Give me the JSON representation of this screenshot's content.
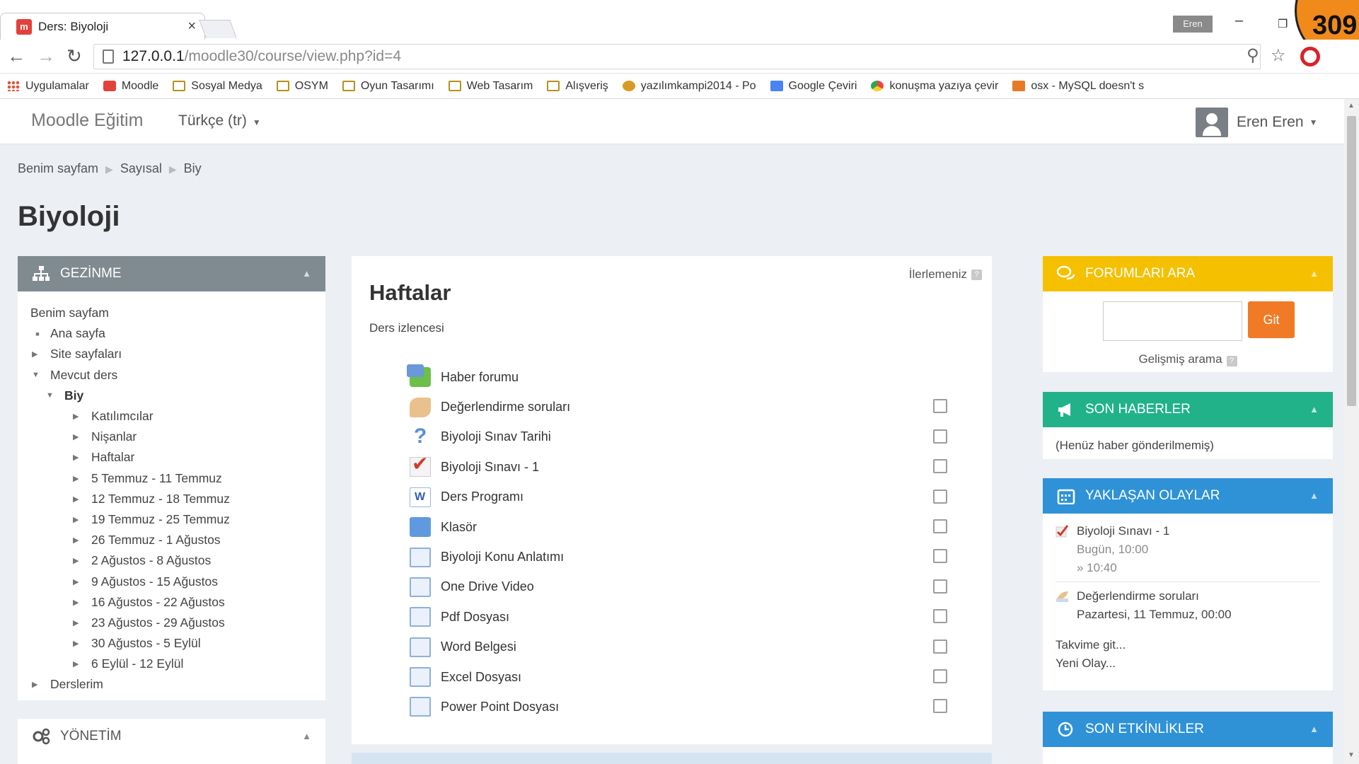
{
  "browser": {
    "tab_title": "Ders: Biyoloji",
    "tab_close": "×",
    "profile_name": "Eren",
    "badge_number": "309",
    "url_host": "127.0.0.1",
    "url_path": "/moodle30/course/view.php?id=4",
    "bookmarks": [
      {
        "label": "Uygulamalar",
        "icon": "apps-icon"
      },
      {
        "label": "Moodle",
        "icon": "moodle-icon"
      },
      {
        "label": "Sosyal Medya",
        "icon": "folder-icon"
      },
      {
        "label": "OSYM",
        "icon": "folder-icon"
      },
      {
        "label": "Oyun Tasarımı",
        "icon": "folder-icon"
      },
      {
        "label": "Web Tasarım",
        "icon": "folder-icon"
      },
      {
        "label": "Alışveriş",
        "icon": "folder-icon"
      },
      {
        "label": "yazılımkampi2014 - Po",
        "icon": "site-icon"
      },
      {
        "label": "Google Çeviri",
        "icon": "translate-icon"
      },
      {
        "label": "konuşma yazıya çevir",
        "icon": "chrome-icon"
      },
      {
        "label": "osx - MySQL doesn't s",
        "icon": "java-icon"
      }
    ]
  },
  "navbar": {
    "brand": "Moodle Eğitim",
    "language": "Türkçe (tr)",
    "user_name": "Eren Eren"
  },
  "breadcrumb": [
    "Benim sayfam",
    "Sayısal",
    "Biy"
  ],
  "page_title": "Biyoloji",
  "navigation_block": {
    "title": "GEZİNME",
    "items": [
      {
        "label": "Benim sayfam",
        "level": 0,
        "marker": "none"
      },
      {
        "label": "Ana sayfa",
        "level": 1,
        "marker": "dot"
      },
      {
        "label": "Site sayfaları",
        "level": 1,
        "marker": "collapsed"
      },
      {
        "label": "Mevcut ders",
        "level": 1,
        "marker": "expanded"
      },
      {
        "label": "Biy",
        "level": 2,
        "marker": "expanded",
        "bold": true
      },
      {
        "label": "Katılımcılar",
        "level": 3,
        "marker": "collapsed"
      },
      {
        "label": "Nişanlar",
        "level": 3,
        "marker": "collapsed"
      },
      {
        "label": "Haftalar",
        "level": 3,
        "marker": "collapsed"
      },
      {
        "label": "5 Temmuz - 11 Temmuz",
        "level": 3,
        "marker": "collapsed"
      },
      {
        "label": "12 Temmuz - 18 Temmuz",
        "level": 3,
        "marker": "collapsed"
      },
      {
        "label": "19 Temmuz - 25 Temmuz",
        "level": 3,
        "marker": "collapsed"
      },
      {
        "label": "26 Temmuz - 1 Ağustos",
        "level": 3,
        "marker": "collapsed"
      },
      {
        "label": "2 Ağustos - 8 Ağustos",
        "level": 3,
        "marker": "collapsed"
      },
      {
        "label": "9 Ağustos - 15 Ağustos",
        "level": 3,
        "marker": "collapsed"
      },
      {
        "label": "16 Ağustos - 22 Ağustos",
        "level": 3,
        "marker": "collapsed"
      },
      {
        "label": "23 Ağustos - 29 Ağustos",
        "level": 3,
        "marker": "collapsed"
      },
      {
        "label": "30 Ağustos - 5 Eylül",
        "level": 3,
        "marker": "collapsed"
      },
      {
        "label": "6 Eylül - 12 Eylül",
        "level": 3,
        "marker": "collapsed"
      },
      {
        "label": "Derslerim",
        "level": 1,
        "marker": "collapsed"
      }
    ]
  },
  "management_block": {
    "title": "YÖNETİM"
  },
  "main": {
    "progress_label": "İlerlemeniz",
    "section_title": "Haftalar",
    "section_summary": "Ders izlencesi",
    "activities": [
      {
        "name": "Haber forumu",
        "icon": "forum-icon",
        "has_checkbox": false
      },
      {
        "name": "Değerlendirme soruları",
        "icon": "feedback-icon",
        "has_checkbox": true
      },
      {
        "name": "Biyoloji Sınav Tarihi",
        "icon": "question-icon",
        "has_checkbox": true
      },
      {
        "name": "Biyoloji Sınavı - 1",
        "icon": "quiz-icon",
        "has_checkbox": true
      },
      {
        "name": "Ders Programı",
        "icon": "word-icon",
        "has_checkbox": true
      },
      {
        "name": "Klasör",
        "icon": "folder-icon",
        "has_checkbox": true
      },
      {
        "name": "Biyoloji Konu Anlatımı",
        "icon": "page-icon",
        "has_checkbox": true
      },
      {
        "name": "One Drive Video",
        "icon": "page-icon",
        "has_checkbox": true
      },
      {
        "name": "Pdf Dosyası",
        "icon": "page-icon",
        "has_checkbox": true
      },
      {
        "name": "Word Belgesi",
        "icon": "page-icon",
        "has_checkbox": true
      },
      {
        "name": "Excel Dosyası",
        "icon": "page-icon",
        "has_checkbox": true
      },
      {
        "name": "Power Point Dosyası",
        "icon": "page-icon",
        "has_checkbox": true
      }
    ]
  },
  "forum_search": {
    "title": "FORUMLARI ARA",
    "input_value": "",
    "go_label": "Git",
    "advanced_label": "Gelişmiş arama"
  },
  "news": {
    "title": "SON HABERLER",
    "empty_text": "(Henüz haber gönderilmemiş)"
  },
  "upcoming": {
    "title": "YAKLAŞAN OLAYLAR",
    "events": [
      {
        "title": "Biyoloji Sınavı - 1",
        "line2": "Bugün, 10:00",
        "line3": "» 10:40"
      },
      {
        "title": "Değerlendirme soruları",
        "line2": "Pazartesi, 11 Temmuz, 00:00"
      }
    ],
    "calendar_link": "Takvime git...",
    "new_event_link": "Yeni Olay..."
  },
  "recent": {
    "title": "SON ETKİNLİKLER"
  },
  "colors": {
    "navigation_header": "#808a91",
    "forum_search_header": "#f5c000",
    "news_header": "#22b28a",
    "upcoming_header": "#2f92d7",
    "go_button": "#f07a25"
  }
}
